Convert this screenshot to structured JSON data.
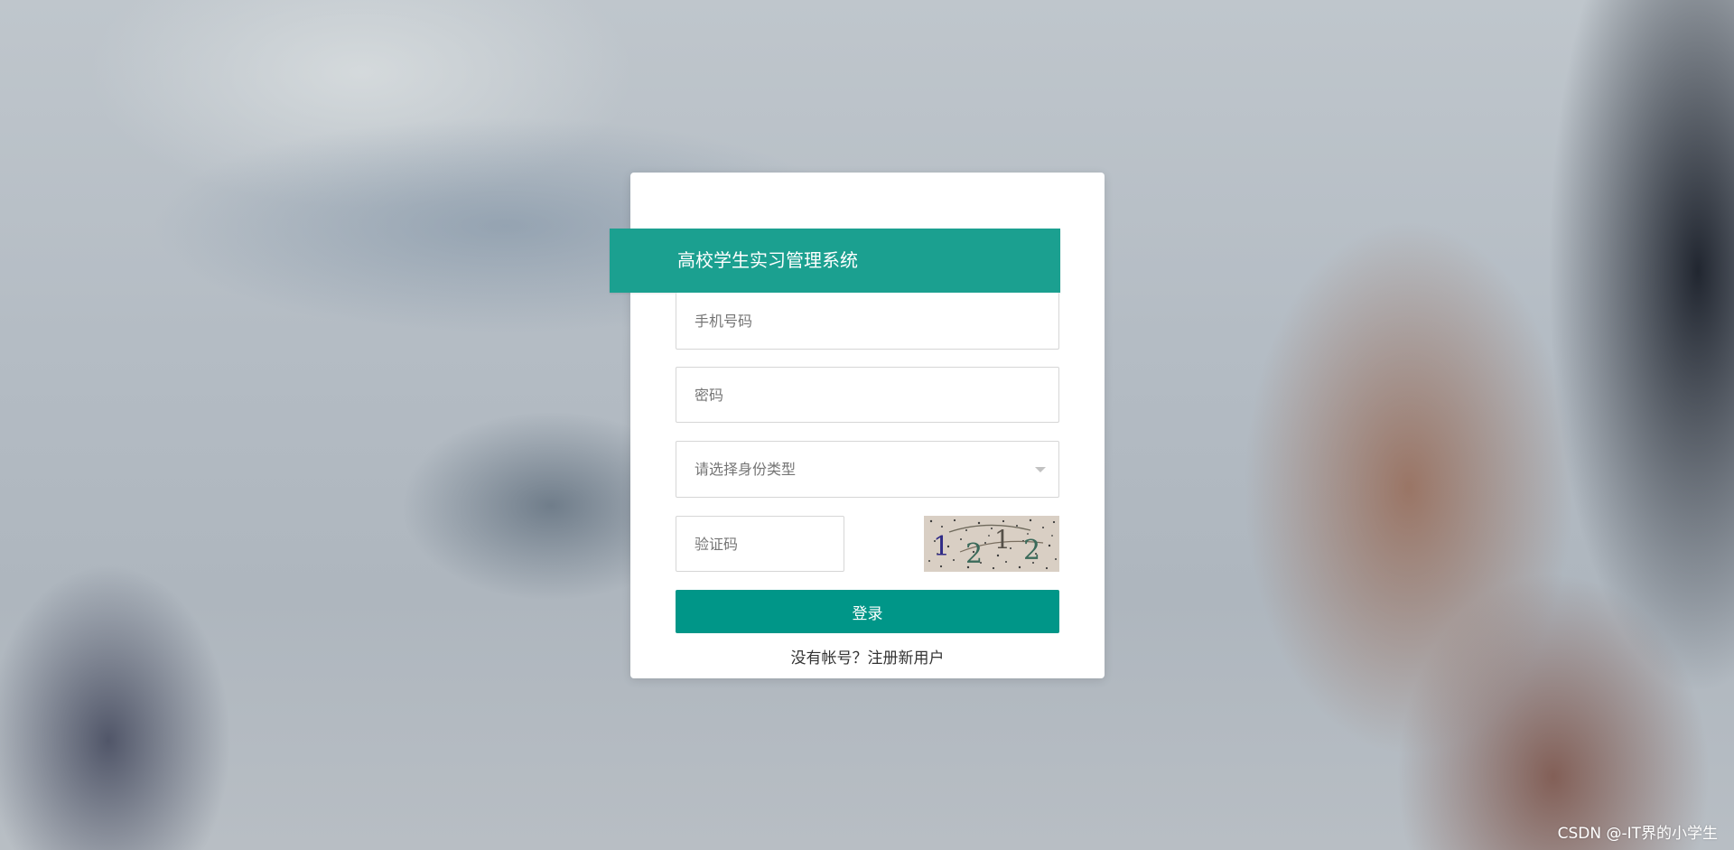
{
  "login": {
    "title": "高校学生实习管理系统",
    "phone_placeholder": "手机号码",
    "password_placeholder": "密码",
    "role_select_placeholder": "请选择身份类型",
    "captcha_placeholder": "验证码",
    "captcha_text": "1 2 1 2",
    "login_button": "登录",
    "register_link": "没有帐号？注册新用户"
  },
  "watermark": "CSDN @-IT界的小学生",
  "colors": {
    "title_ribbon": "#1ba090",
    "login_button": "#009688"
  }
}
